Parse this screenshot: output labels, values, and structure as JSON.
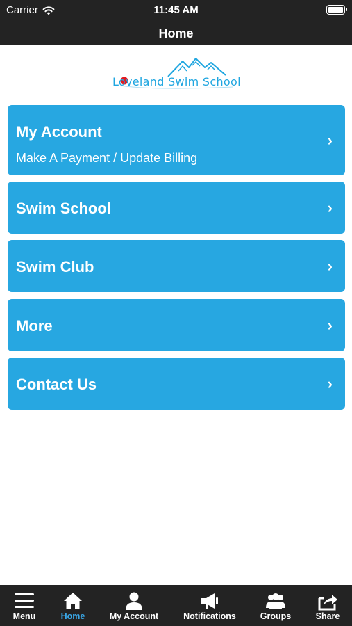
{
  "status_bar": {
    "carrier": "Carrier",
    "time": "11:45 AM"
  },
  "nav": {
    "title": "Home"
  },
  "logo": {
    "text": "Loveland Swim School"
  },
  "menu": [
    {
      "title": "My Account",
      "subtitle": "Make A Payment / Update Billing",
      "chevron": "›"
    },
    {
      "title": "Swim School",
      "chevron": "›"
    },
    {
      "title": "Swim Club",
      "chevron": "›"
    },
    {
      "title": "More",
      "chevron": "›"
    },
    {
      "title": "Contact Us",
      "chevron": "›"
    }
  ],
  "tabs": [
    {
      "label": "Menu",
      "icon": "hamburger-icon"
    },
    {
      "label": "Home",
      "icon": "home-icon",
      "active": true
    },
    {
      "label": "My Account",
      "icon": "person-icon"
    },
    {
      "label": "Notifications",
      "icon": "megaphone-icon"
    },
    {
      "label": "Groups",
      "icon": "group-icon"
    },
    {
      "label": "Share",
      "icon": "share-icon"
    }
  ],
  "colors": {
    "bar": "#232323",
    "card": "#27a7e1",
    "active_tab": "#3aa8e8"
  }
}
